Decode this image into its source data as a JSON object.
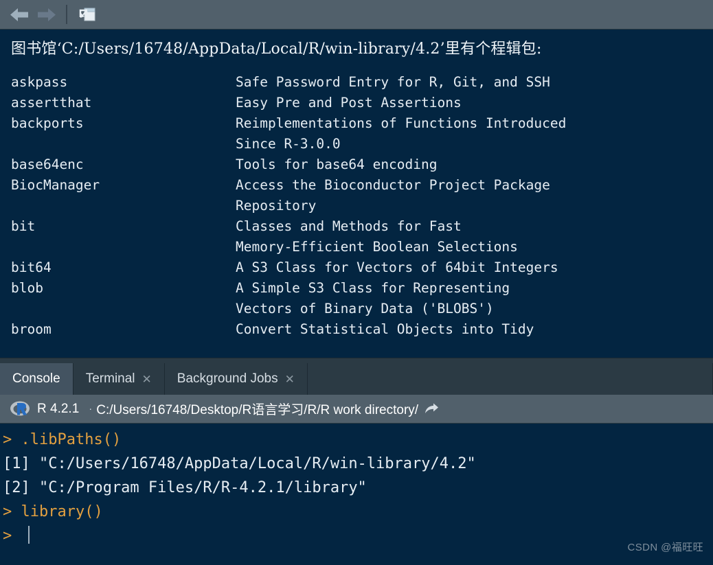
{
  "toolbar": {
    "back_icon": "arrow-left-icon",
    "forward_icon": "arrow-right-icon",
    "show_in_new_window_icon": "show-in-new-window-icon",
    "back_label": "Back",
    "forward_label": "Forward",
    "show_in_new_window_label": "Show in new window"
  },
  "viewer": {
    "title": "图书馆‘C:/Users/16748/AppData/Local/R/win-library/4.2’里有个程辑包:",
    "packages": [
      {
        "name": "askpass",
        "desc": "Safe Password Entry for R, Git, and SSH"
      },
      {
        "name": "assertthat",
        "desc": "Easy Pre and Post Assertions"
      },
      {
        "name": "backports",
        "desc": "Reimplementations of Functions Introduced\nSince R-3.0.0"
      },
      {
        "name": "base64enc",
        "desc": "Tools for base64 encoding"
      },
      {
        "name": "BiocManager",
        "desc": "Access the Bioconductor Project Package\nRepository"
      },
      {
        "name": "bit",
        "desc": "Classes and Methods for Fast\nMemory-Efficient Boolean Selections"
      },
      {
        "name": "bit64",
        "desc": "A S3 Class for Vectors of 64bit Integers"
      },
      {
        "name": "blob",
        "desc": "A Simple S3 Class for Representing\nVectors of Binary Data ('BLOBS')"
      },
      {
        "name": "broom",
        "desc": "Convert Statistical Objects into Tidy"
      }
    ]
  },
  "tabs": [
    {
      "label": "Console",
      "active": true,
      "closable": false,
      "close_glyph": ""
    },
    {
      "label": "Terminal",
      "active": false,
      "closable": true,
      "close_glyph": "✕"
    },
    {
      "label": "Background Jobs",
      "active": false,
      "closable": true,
      "close_glyph": "✕"
    }
  ],
  "versionbar": {
    "logo_icon": "r-logo-icon",
    "version": "R 4.2.1",
    "separator": "·",
    "working_directory": "C:/Users/16748/Desktop/R语言学习/R/R work directory/",
    "goto_icon": "go-to-directory-icon"
  },
  "console": {
    "lines": [
      {
        "type": "input",
        "prompt": "> ",
        "text": ".libPaths()"
      },
      {
        "type": "output",
        "prompt": "",
        "text": "[1] \"C:/Users/16748/AppData/Local/R/win-library/4.2\""
      },
      {
        "type": "output",
        "prompt": "",
        "text": "[2] \"C:/Program Files/R/R-4.2.1/library\""
      },
      {
        "type": "input",
        "prompt": "> ",
        "text": "library()"
      },
      {
        "type": "caret",
        "prompt": "> ",
        "text": ""
      }
    ]
  },
  "watermark": "CSDN @福旺旺",
  "colors": {
    "console_bg": "#032541",
    "toolbar_bg": "#51606b",
    "tabbar_bg": "#2b3a44",
    "tab_active_bg": "#435361",
    "prompt_orange": "#e3a040",
    "text": "#e6edf3",
    "r_logo_blue": "#276dc2"
  }
}
